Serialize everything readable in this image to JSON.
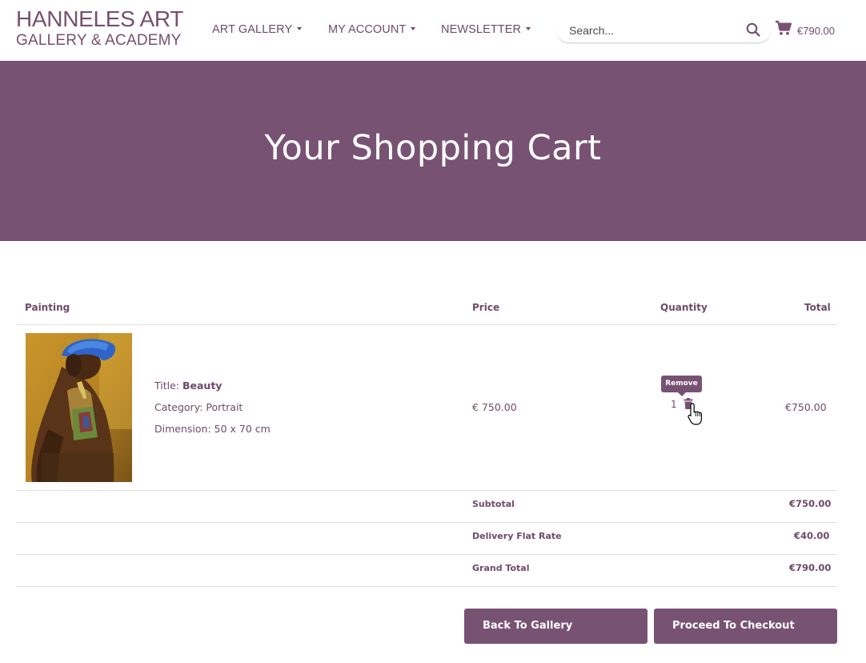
{
  "brand": {
    "line1": "HANNELES ART",
    "line2": "GALLERY & ACADEMY"
  },
  "nav": {
    "items": [
      {
        "label": "ART GALLERY"
      },
      {
        "label": "MY ACCOUNT"
      },
      {
        "label": "NEWSLETTER"
      }
    ]
  },
  "search": {
    "placeholder": "Search..."
  },
  "cart": {
    "total": "€790.00"
  },
  "hero": {
    "title": "Your Shopping Cart"
  },
  "table": {
    "headers": {
      "painting": "Painting",
      "price": "Price",
      "quantity": "Quantity",
      "total": "Total"
    },
    "row": {
      "title_label": "Title: ",
      "title": "Beauty",
      "category": "Category: Portrait",
      "dimension": "Dimension: 50 x 70 cm",
      "price": "€ 750.00",
      "quantity": "1",
      "total": "€750.00",
      "remove_tooltip": "Remove"
    },
    "summary": [
      {
        "label": "Subtotal",
        "value": "€750.00"
      },
      {
        "label": "Delivery Flat Rate",
        "value": "€40.00"
      },
      {
        "label": "Grand Total",
        "value": "€790.00"
      }
    ]
  },
  "buttons": {
    "back": "Back To Gallery",
    "checkout": "Proceed To Checkout"
  },
  "colors": {
    "accent": "#785273",
    "text": "#6f4a6b"
  }
}
